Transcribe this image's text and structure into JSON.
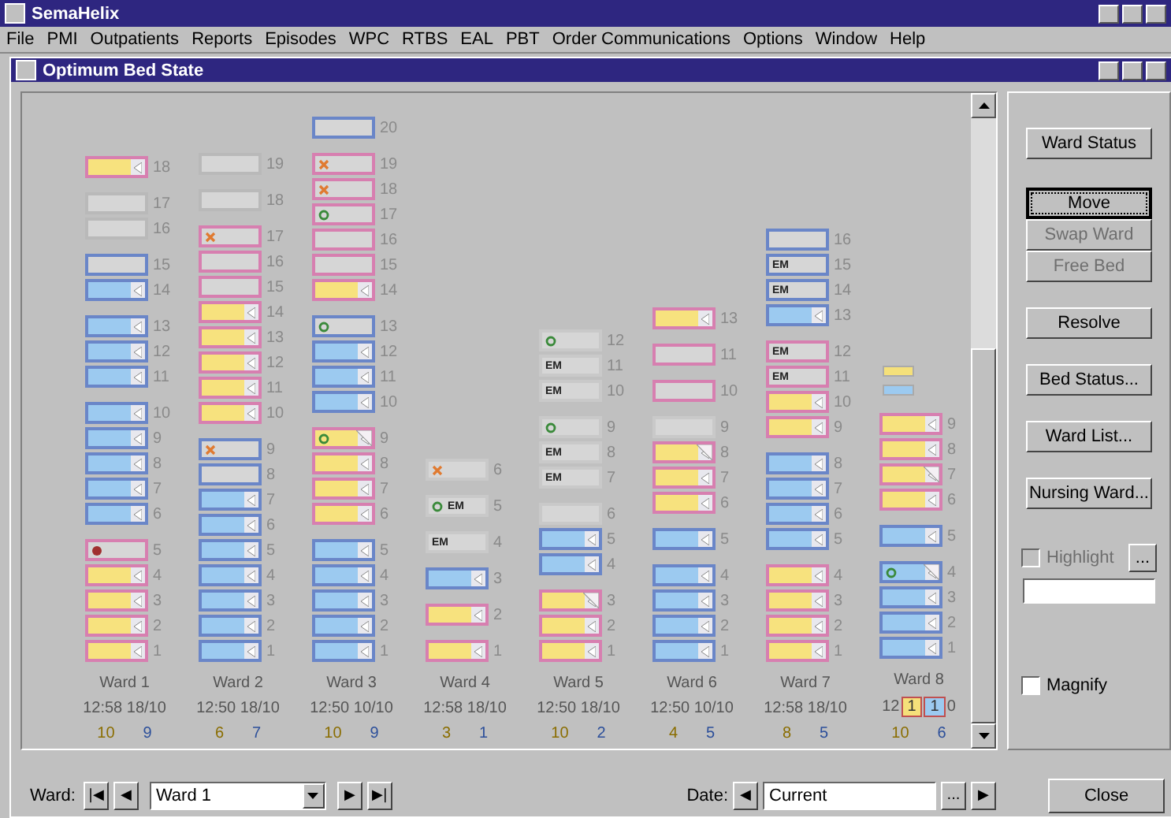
{
  "app": {
    "title": "SemaHelix"
  },
  "menu": [
    "File",
    "PMI",
    "Outpatients",
    "Reports",
    "Episodes",
    "WPC",
    "RTBS",
    "EAL",
    "PBT",
    "Order Communications",
    "Options",
    "Window",
    "Help"
  ],
  "window": {
    "title": "Optimum Bed State"
  },
  "wards": [
    {
      "name": "Ward 1",
      "time": "12:58 18/10",
      "female_count": "10",
      "male_count": "9",
      "groups": [
        [
          {
            "number": "18",
            "kind": "female",
            "color": "#d77fb0"
          }
        ],
        [
          {
            "number": "17",
            "kind": "empty",
            "color": "#b9b9b9"
          },
          {
            "number": "16",
            "kind": "empty",
            "color": "#b9b9b9"
          }
        ],
        [
          {
            "number": "15",
            "kind": "empty",
            "color": "#6a86c8"
          },
          {
            "number": "14",
            "kind": "male",
            "color": "#6a86c8"
          }
        ],
        [
          {
            "number": "13",
            "kind": "male",
            "color": "#6a86c8"
          },
          {
            "number": "12",
            "kind": "male",
            "color": "#6a86c8"
          },
          {
            "number": "11",
            "kind": "male",
            "color": "#6a86c8"
          }
        ],
        [
          {
            "number": "10",
            "kind": "male",
            "color": "#6a86c8"
          },
          {
            "number": "9",
            "kind": "male",
            "color": "#6a86c8"
          },
          {
            "number": "8",
            "kind": "male",
            "color": "#6a86c8"
          },
          {
            "number": "7",
            "kind": "male",
            "color": "#6a86c8"
          },
          {
            "number": "6",
            "kind": "male",
            "color": "#6a86c8"
          }
        ],
        [
          {
            "number": "5",
            "kind": "empty",
            "color": "#d77fb0",
            "icon": {
              "kind": "dot"
            }
          },
          {
            "number": "4",
            "kind": "female",
            "color": "#d77fb0"
          },
          {
            "number": "3",
            "kind": "female",
            "color": "#d77fb0"
          },
          {
            "number": "2",
            "kind": "female",
            "color": "#d77fb0"
          },
          {
            "number": "1",
            "kind": "female",
            "color": "#d77fb0"
          }
        ]
      ]
    },
    {
      "name": "Ward 2",
      "time": "12:50 18/10",
      "female_count": "6",
      "male_count": "7",
      "groups": [
        [
          {
            "number": "19",
            "kind": "empty",
            "color": "#b9b9b9"
          }
        ],
        [
          {
            "number": "18",
            "kind": "empty",
            "color": "#b9b9b9"
          }
        ],
        [
          {
            "number": "17",
            "kind": "empty",
            "color": "#d77fb0",
            "icon": {
              "kind": "cross"
            }
          },
          {
            "number": "16",
            "kind": "empty",
            "color": "#d77fb0"
          },
          {
            "number": "15",
            "kind": "empty",
            "color": "#d77fb0"
          },
          {
            "number": "14",
            "kind": "female",
            "color": "#d77fb0"
          },
          {
            "number": "13",
            "kind": "female",
            "color": "#d77fb0"
          },
          {
            "number": "12",
            "kind": "female",
            "color": "#d77fb0"
          },
          {
            "number": "11",
            "kind": "female",
            "color": "#d77fb0"
          },
          {
            "number": "10",
            "kind": "female",
            "color": "#d77fb0"
          }
        ],
        [
          {
            "number": "9",
            "kind": "empty",
            "color": "#6a86c8",
            "icon": {
              "kind": "cross"
            }
          },
          {
            "number": "8",
            "kind": "empty",
            "color": "#6a86c8"
          },
          {
            "number": "7",
            "kind": "male",
            "color": "#6a86c8"
          },
          {
            "number": "6",
            "kind": "male",
            "color": "#6a86c8"
          },
          {
            "number": "5",
            "kind": "male",
            "color": "#6a86c8"
          },
          {
            "number": "4",
            "kind": "male",
            "color": "#6a86c8"
          },
          {
            "number": "3",
            "kind": "male",
            "color": "#6a86c8"
          },
          {
            "number": "2",
            "kind": "male",
            "color": "#6a86c8"
          },
          {
            "number": "1",
            "kind": "male",
            "color": "#6a86c8"
          }
        ]
      ]
    },
    {
      "name": "Ward 3",
      "time": "12:50 10/10",
      "female_count": "10",
      "male_count": "9",
      "groups": [
        [
          {
            "number": "20",
            "kind": "empty",
            "color": "#6a86c8"
          }
        ],
        [
          {
            "number": "19",
            "kind": "empty",
            "color": "#d77fb0",
            "icon": {
              "kind": "cross"
            }
          },
          {
            "number": "18",
            "kind": "empty",
            "color": "#d77fb0",
            "icon": {
              "kind": "cross"
            }
          },
          {
            "number": "17",
            "kind": "empty",
            "color": "#d77fb0",
            "icon": {
              "kind": "ring"
            }
          },
          {
            "number": "16",
            "kind": "empty",
            "color": "#d77fb0"
          },
          {
            "number": "15",
            "kind": "empty",
            "color": "#d77fb0"
          },
          {
            "number": "14",
            "kind": "female",
            "color": "#d77fb0"
          }
        ],
        [
          {
            "number": "13",
            "kind": "empty",
            "color": "#6a86c8",
            "icon": {
              "kind": "ring"
            }
          },
          {
            "number": "12",
            "kind": "male",
            "color": "#6a86c8"
          },
          {
            "number": "11",
            "kind": "male",
            "color": "#6a86c8"
          },
          {
            "number": "10",
            "kind": "male",
            "color": "#6a86c8"
          }
        ],
        [
          {
            "number": "9",
            "kind": "female",
            "color": "#d77fb0",
            "icon": {
              "kind": "ring-fold"
            }
          },
          {
            "number": "8",
            "kind": "female",
            "color": "#d77fb0"
          },
          {
            "number": "7",
            "kind": "female",
            "color": "#d77fb0"
          },
          {
            "number": "6",
            "kind": "female",
            "color": "#d77fb0"
          }
        ],
        [
          {
            "number": "5",
            "kind": "male",
            "color": "#6a86c8"
          },
          {
            "number": "4",
            "kind": "male",
            "color": "#6a86c8"
          },
          {
            "number": "3",
            "kind": "male",
            "color": "#6a86c8"
          },
          {
            "number": "2",
            "kind": "male",
            "color": "#6a86c8"
          },
          {
            "number": "1",
            "kind": "male",
            "color": "#6a86c8"
          }
        ]
      ]
    },
    {
      "name": "Ward 4",
      "time": "12:58 18/10",
      "female_count": "3",
      "male_count": "1",
      "groups": [
        [
          {
            "number": "6",
            "kind": "empty",
            "color": "#c9c9c9",
            "icon": {
              "kind": "cross"
            }
          }
        ],
        [
          {
            "number": "5",
            "kind": "empty",
            "color": "#c9c9c9",
            "icon": {
              "kind": "ring"
            },
            "label": "EM"
          }
        ],
        [
          {
            "number": "4",
            "kind": "empty",
            "color": "#c9c9c9",
            "label": "EM"
          }
        ],
        [
          {
            "number": "3",
            "kind": "male",
            "color": "#6a86c8"
          }
        ],
        [
          {
            "number": "2",
            "kind": "female",
            "color": "#d77fb0"
          }
        ],
        [
          {
            "number": "1",
            "kind": "female",
            "color": "#d77fb0"
          }
        ]
      ]
    },
    {
      "name": "Ward 5",
      "time": "12:50 18/10",
      "female_count": "10",
      "male_count": "2",
      "groups": [
        [
          {
            "number": "12",
            "kind": "empty",
            "color": "#c9c9c9",
            "icon": {
              "kind": "ring"
            }
          },
          {
            "number": "11",
            "kind": "empty",
            "color": "#c9c9c9",
            "label": "EM"
          },
          {
            "number": "10",
            "kind": "empty",
            "color": "#c9c9c9",
            "label": "EM"
          }
        ],
        [
          {
            "number": "9",
            "kind": "empty",
            "color": "#c9c9c9",
            "icon": {
              "kind": "ring"
            }
          },
          {
            "number": "8",
            "kind": "empty",
            "color": "#c9c9c9",
            "label": "EM"
          },
          {
            "number": "7",
            "kind": "empty",
            "color": "#c9c9c9",
            "label": "EM"
          }
        ],
        [
          {
            "number": "6",
            "kind": "empty",
            "color": "#c9c9c9"
          },
          {
            "number": "5",
            "kind": "male",
            "color": "#6a86c8"
          },
          {
            "number": "4",
            "kind": "male",
            "color": "#6a86c8"
          }
        ],
        [
          {
            "number": "3",
            "kind": "female",
            "color": "#d77fb0",
            "icon": {
              "kind": "fold"
            }
          },
          {
            "number": "2",
            "kind": "female",
            "color": "#d77fb0"
          },
          {
            "number": "1",
            "kind": "female",
            "color": "#d77fb0"
          }
        ]
      ]
    },
    {
      "name": "Ward 6",
      "time": "12:50 10/10",
      "female_count": "4",
      "male_count": "5",
      "groups": [
        [
          {
            "number": "13",
            "kind": "female",
            "color": "#d77fb0"
          }
        ],
        [
          {
            "number": "11",
            "kind": "empty",
            "color": "#d77fb0"
          }
        ],
        [
          {
            "number": "10",
            "kind": "empty",
            "color": "#d77fb0"
          }
        ],
        [
          {
            "number": "9",
            "kind": "empty",
            "color": "#c9c9c9"
          },
          {
            "number": "8",
            "kind": "female",
            "color": "#d77fb0",
            "icon": {
              "kind": "fold"
            }
          },
          {
            "number": "7",
            "kind": "female",
            "color": "#d77fb0"
          },
          {
            "number": "6",
            "kind": "female",
            "color": "#d77fb0"
          }
        ],
        [
          {
            "number": "5",
            "kind": "male",
            "color": "#6a86c8"
          }
        ],
        [
          {
            "number": "4",
            "kind": "male",
            "color": "#6a86c8"
          },
          {
            "number": "3",
            "kind": "male",
            "color": "#6a86c8"
          },
          {
            "number": "2",
            "kind": "male",
            "color": "#6a86c8"
          },
          {
            "number": "1",
            "kind": "male",
            "color": "#6a86c8"
          }
        ]
      ]
    },
    {
      "name": "Ward 7",
      "time": "12:58 18/10",
      "female_count": "8",
      "male_count": "5",
      "groups": [
        [
          {
            "number": "16",
            "kind": "empty",
            "color": "#6a86c8"
          },
          {
            "number": "15",
            "kind": "empty",
            "color": "#6a86c8",
            "label": "EM"
          },
          {
            "number": "14",
            "kind": "empty",
            "color": "#6a86c8",
            "label": "EM"
          },
          {
            "number": "13",
            "kind": "male",
            "color": "#6a86c8"
          }
        ],
        [
          {
            "number": "12",
            "kind": "empty",
            "color": "#d77fb0",
            "label": "EM"
          },
          {
            "number": "11",
            "kind": "empty",
            "color": "#d77fb0",
            "label": "EM"
          },
          {
            "number": "10",
            "kind": "female",
            "color": "#d77fb0"
          },
          {
            "number": "9",
            "kind": "female",
            "color": "#d77fb0"
          }
        ],
        [
          {
            "number": "8",
            "kind": "male",
            "color": "#6a86c8"
          },
          {
            "number": "7",
            "kind": "male",
            "color": "#6a86c8"
          },
          {
            "number": "6",
            "kind": "male",
            "color": "#6a86c8"
          },
          {
            "number": "5",
            "kind": "male",
            "color": "#6a86c8"
          }
        ],
        [
          {
            "number": "4",
            "kind": "female",
            "color": "#d77fb0"
          },
          {
            "number": "3",
            "kind": "female",
            "color": "#d77fb0"
          },
          {
            "number": "2",
            "kind": "female",
            "color": "#d77fb0"
          },
          {
            "number": "1",
            "kind": "female",
            "color": "#d77fb0"
          }
        ]
      ]
    },
    {
      "name": "Ward 8",
      "time_start": "12",
      "time_end": "0",
      "badges": [
        {
          "text": "1",
          "color": "#f5e07a"
        },
        {
          "text": "1",
          "color": "#9ccaf0"
        }
      ],
      "female_count": "10",
      "male_count": "6",
      "markers": [
        {
          "color": "#f5e07a"
        },
        {
          "color": "#9ccaf0"
        }
      ],
      "groups": [
        [
          {
            "number": "9",
            "kind": "female",
            "color": "#d77fb0"
          },
          {
            "number": "8",
            "kind": "female",
            "color": "#d77fb0"
          },
          {
            "number": "7",
            "kind": "female",
            "color": "#d77fb0",
            "icon": {
              "kind": "fold"
            }
          },
          {
            "number": "6",
            "kind": "female",
            "color": "#d77fb0"
          }
        ],
        [
          {
            "number": "5",
            "kind": "male",
            "color": "#6a86c8"
          }
        ],
        [
          {
            "number": "4",
            "kind": "male",
            "color": "#6a86c8",
            "icon": {
              "kind": "ring-fold"
            }
          },
          {
            "number": "3",
            "kind": "male",
            "color": "#6a86c8"
          },
          {
            "number": "2",
            "kind": "male",
            "color": "#6a86c8"
          },
          {
            "number": "1",
            "kind": "male",
            "color": "#6a86c8"
          }
        ]
      ]
    }
  ],
  "side_buttons": [
    {
      "label": "Ward Status",
      "disabled": false,
      "focused": false
    },
    {
      "label": "Move",
      "disabled": false,
      "focused": true
    },
    {
      "label": "Swap Ward",
      "disabled": true,
      "focused": false
    },
    {
      "label": "Free Bed",
      "disabled": true,
      "focused": false
    },
    {
      "label": "Resolve",
      "disabled": false,
      "focused": false
    },
    {
      "label": "Bed Status...",
      "disabled": false,
      "focused": false
    },
    {
      "label": "Ward List...",
      "disabled": false,
      "focused": false
    },
    {
      "label": "Nursing Ward...",
      "disabled": false,
      "focused": false
    }
  ],
  "highlight": {
    "label": "Highlight",
    "checked": false,
    "disabled": true,
    "browse": "..."
  },
  "magnify": {
    "label": "Magnify",
    "checked": false
  },
  "bottom": {
    "ward_label": "Ward:",
    "first": "|◀",
    "prev": "◀",
    "ward": "Ward 1",
    "next": "▶",
    "last": "▶|",
    "date_label": "Date:",
    "date_prev": "◀",
    "date": "Current",
    "date_browse": "...",
    "date_next": "▶",
    "close": "Close"
  }
}
